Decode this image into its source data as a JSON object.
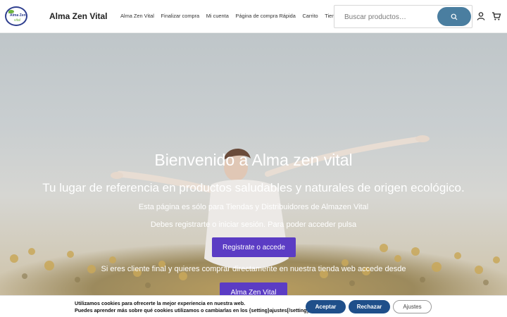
{
  "header": {
    "logo_text_top": "Alma Zen",
    "logo_text_bottom": "vital",
    "brand": "Alma Zen Vital",
    "nav": [
      {
        "label": "Alma Zen Vital"
      },
      {
        "label": "Finalizar compra"
      },
      {
        "label": "Mi cuenta"
      },
      {
        "label": "Página de compra Rápida"
      },
      {
        "label": "Carrito"
      },
      {
        "label": "Tienda"
      }
    ],
    "search_placeholder": "Buscar productos…",
    "icons": {
      "search": "search-icon",
      "account": "user-icon",
      "cart": "cart-icon"
    }
  },
  "hero": {
    "title": "Bienvenido a Alma zen vital",
    "subtitle": "Tu lugar de referencia en productos saludables y naturales de origen ecológico.",
    "line1": "Esta página es sólo para Tiendas y Distribuidores de Almazen Vital",
    "line2": "Debes registrarte o iniciar sesión. Para poder acceder pulsa",
    "button1": "Registrate o accede",
    "line3": "Si eres cliente final y quieres comprar directamente en nuestra tienda web accede desde",
    "button2": "Alma Zen Vital"
  },
  "cookie": {
    "line1": "Utilizamos cookies para ofrecerte la mejor experiencia en nuestra web.",
    "line2": "Puedes aprender más sobre qué cookies utilizamos o cambiarlas en los {setting}ajustes[/setting].",
    "accept": "Aceptar",
    "reject": "Rechazar",
    "settings": "Ajustes"
  },
  "colors": {
    "accent": "#5b3cc4",
    "search_button": "#4a7ea0",
    "cookie_button": "#1f4f8a"
  }
}
